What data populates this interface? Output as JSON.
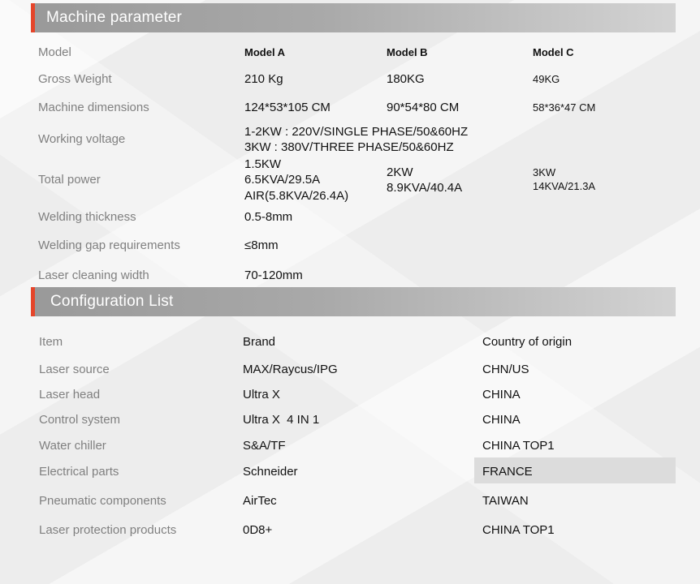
{
  "machine_parameter": {
    "title": "Machine parameter",
    "model": {
      "label": "Model",
      "a": "Model A",
      "b": "Model B",
      "c": "Model C"
    },
    "gross_weight": {
      "label": "Gross Weight",
      "a": "210 Kg",
      "b": "180KG",
      "c": "49KG"
    },
    "dimensions": {
      "label": "Machine dimensions",
      "a": "124*53*105 CM",
      "b": "90*54*80 CM",
      "c": "58*36*47 CM"
    },
    "voltage": {
      "label": "Working voltage",
      "line1": "1-2KW : 220V/SINGLE PHASE/50&60HZ",
      "line2": "3KW : 380V/THREE PHASE/50&60HZ"
    },
    "power": {
      "label": "Total power",
      "a": [
        "1.5KW",
        "6.5KVA/29.5A",
        "AIR(5.8KVA/26.4A)"
      ],
      "b": [
        "2KW",
        "8.9KVA/40.4A"
      ],
      "c": [
        "3KW",
        "14KVA/21.3A"
      ]
    },
    "thickness": {
      "label": "Welding thickness",
      "value": "0.5-8mm"
    },
    "gap": {
      "label": "Welding gap requirements",
      "value": "≤8mm"
    },
    "cleaning": {
      "label": "Laser cleaning width",
      "value": "70-120mm"
    }
  },
  "configuration_list": {
    "title": "Configuration List",
    "header": {
      "item": "Item",
      "brand": "Brand",
      "country": "Country of origin"
    },
    "rows": [
      {
        "item": "Laser source",
        "brand": "MAX/Raycus/IPG",
        "country": "CHN/US"
      },
      {
        "item": "Laser head",
        "brand": "Ultra X",
        "country": "CHINA"
      },
      {
        "item": "Control system",
        "brand": "Ultra X  4 IN 1",
        "country": "CHINA"
      },
      {
        "item": "Water chiller",
        "brand": "S&A/TF",
        "country": "CHINA TOP1"
      },
      {
        "item": "Electrical parts",
        "brand": "Schneider",
        "country": "FRANCE"
      },
      {
        "item": "Pneumatic components",
        "brand": "AirTec",
        "country": "TAIWAN"
      },
      {
        "item": "Laser protection products",
        "brand": "0D8+",
        "country": "CHINA TOP1"
      }
    ]
  },
  "colors": {
    "accent": "#e5452a",
    "header_bg": "#a9a9a9",
    "label_text": "#808080",
    "highlight": "#dcdcdc"
  }
}
